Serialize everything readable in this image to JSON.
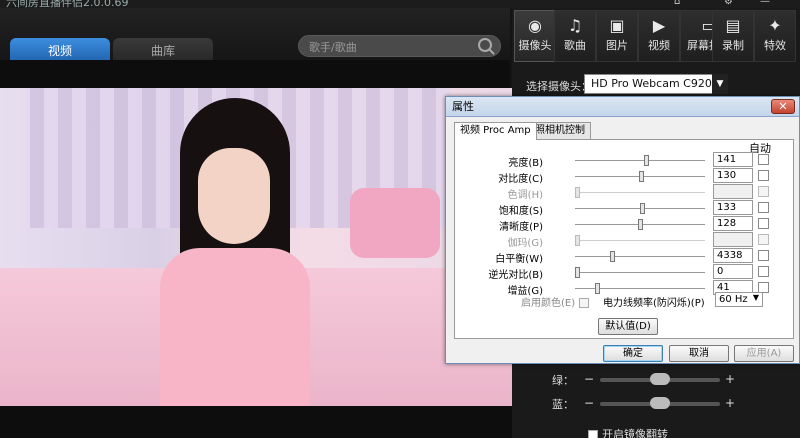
{
  "window": {
    "title": "六间房直播伴侣2.0.0.69"
  },
  "main_tabs": [
    {
      "label": "视频",
      "active": true
    },
    {
      "label": "曲库",
      "active": false
    }
  ],
  "search": {
    "placeholder": "歌手/歌曲"
  },
  "toolbar": [
    {
      "label": "摄像头",
      "icon": "camera-icon",
      "selected": true
    },
    {
      "label": "歌曲",
      "icon": "music-note-icon"
    },
    {
      "label": "图片",
      "icon": "picture-icon"
    },
    {
      "label": "视频",
      "icon": "video-icon"
    },
    {
      "label": "屏幕捕捉",
      "icon": "screen-capture-icon"
    },
    {
      "label": "录制",
      "icon": "film-icon"
    },
    {
      "label": "特效",
      "icon": "sparkle-icon"
    }
  ],
  "camera": {
    "select_label": "选择摄像头：",
    "selected": "HD Pro Webcam C920"
  },
  "color_rows": [
    {
      "label": "绿：",
      "minus": "−",
      "plus": "+"
    },
    {
      "label": "蓝：",
      "minus": "−",
      "plus": "+"
    }
  ],
  "mirror": {
    "label": "开启镜像翻转"
  },
  "dialog": {
    "title": "属性",
    "close": "✕",
    "tabs": [
      "视频 Proc Amp",
      "照相机控制"
    ],
    "auto_header": "自动",
    "properties": [
      {
        "label": "亮度(B)",
        "value": "141",
        "enabled": true,
        "level": 0.55
      },
      {
        "label": "对比度(C)",
        "value": "130",
        "enabled": true,
        "level": 0.51
      },
      {
        "label": "色调(H)",
        "value": "",
        "enabled": false,
        "level": 0.0
      },
      {
        "label": "饱和度(S)",
        "value": "133",
        "enabled": true,
        "level": 0.52
      },
      {
        "label": "清晰度(P)",
        "value": "128",
        "enabled": true,
        "level": 0.5
      },
      {
        "label": "伽玛(G)",
        "value": "",
        "enabled": false,
        "level": 0.0
      },
      {
        "label": "白平衡(W)",
        "value": "4338",
        "enabled": true,
        "level": 0.28
      },
      {
        "label": "逆光对比(B)",
        "value": "0",
        "enabled": true,
        "level": 0.0
      },
      {
        "label": "增益(G)",
        "value": "41",
        "enabled": true,
        "level": 0.16
      }
    ],
    "enable_color": "启用颜色(E)",
    "powerline_label": "电力线频率(防闪烁)(P)",
    "powerline_value": "60 Hz",
    "default_button": "默认值(D)",
    "ok": "确定",
    "cancel": "取消",
    "apply": "应用(A)"
  }
}
